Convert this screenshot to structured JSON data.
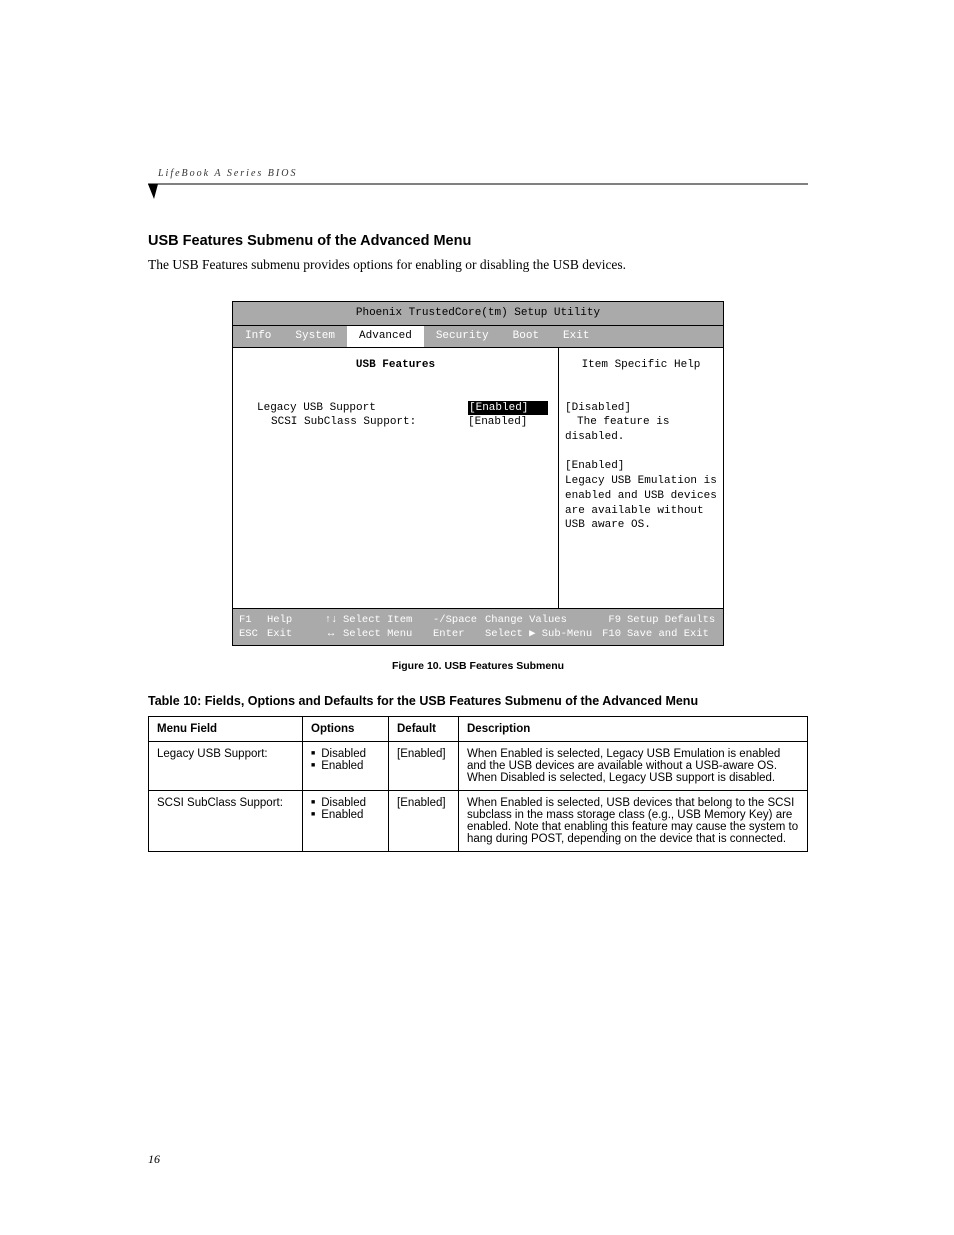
{
  "running_head": "LifeBook A Series BIOS",
  "section_title": "USB Features Submenu of the Advanced Menu",
  "intro_text": "The USB Features submenu provides options for enabling or disabling the USB devices.",
  "bios": {
    "title": "Phoenix TrustedCore(tm) Setup Utility",
    "tabs": [
      "Info",
      "System",
      "Advanced",
      "Security",
      "Boot",
      "Exit"
    ],
    "active_tab": "Advanced",
    "submenu_title": "USB Features",
    "help_title": "Item Specific Help",
    "fields": [
      {
        "label": "Legacy USB Support",
        "value": "[Enabled]",
        "selected": true,
        "indent": false
      },
      {
        "label": "SCSI SubClass Support:",
        "value": "[Enabled]",
        "selected": false,
        "indent": true
      }
    ],
    "help": {
      "disabled_key": "[Disabled]",
      "disabled_text": "The feature is disabled.",
      "enabled_key": "[Enabled]",
      "enabled_text": "Legacy USB Emulation is enabled and USB devices are available without USB aware OS."
    },
    "footer": {
      "row1": {
        "k1": "F1",
        "a1": "Help",
        "k2": "↑↓",
        "a2": "Select Item",
        "k3": "-/Space",
        "a3": "Change Values",
        "k4": "F9",
        "a4": "Setup Defaults"
      },
      "row2": {
        "k1": "ESC",
        "a1": "Exit",
        "k2": "↔",
        "a2": "Select Menu",
        "k3": "Enter",
        "a3": "Select ▶ Sub-Menu",
        "k4": "F10",
        "a4": "Save and Exit"
      }
    }
  },
  "figure_caption": "Figure 10.  USB Features Submenu",
  "table_caption": "Table 10: Fields, Options and Defaults for the USB Features Submenu of the Advanced Menu",
  "table": {
    "headers": [
      "Menu Field",
      "Options",
      "Default",
      "Description"
    ],
    "rows": [
      {
        "field": "Legacy USB Support:",
        "options": [
          "Disabled",
          "Enabled"
        ],
        "default": "[Enabled]",
        "description": "When Enabled is selected, Legacy USB Emulation is enabled and the USB devices are available without a USB-aware OS. When Disabled is selected, Legacy USB support is disabled."
      },
      {
        "field": "SCSI SubClass Support:",
        "options": [
          "Disabled",
          "Enabled"
        ],
        "default": "[Enabled]",
        "description": "When Enabled is selected, USB devices that belong to the SCSI subclass in the mass storage class (e.g., USB Memory Key) are enabled. Note that enabling this feature may cause the system to hang during POST, depending on the device that is connected."
      }
    ]
  },
  "page_number": "16"
}
